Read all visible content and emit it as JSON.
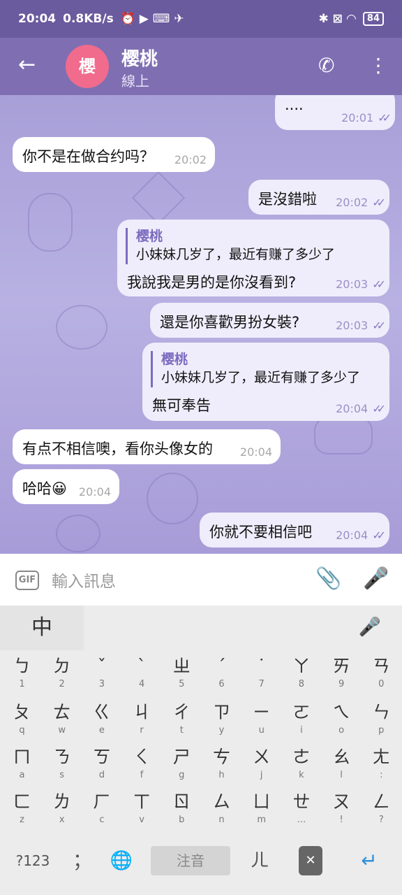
{
  "status_bar": {
    "time": "20:04",
    "speed": "0.8KB/s",
    "battery": "84",
    "left_icons": "⏰ ▶ ⌨ ✈",
    "right_icons": "✱ ⊠ ◠"
  },
  "header": {
    "back_icon": "←",
    "avatar_initial": "櫻",
    "contact_name": "樱桃",
    "presence": "線上",
    "call_icon": "✆",
    "menu_icon": "⋮"
  },
  "messages": [
    {
      "side": "out",
      "text": "....",
      "time": "20:01"
    },
    {
      "side": "in",
      "text": "你不是在做合约吗？",
      "time": "20:02"
    },
    {
      "side": "out",
      "text": "是沒錯啦",
      "time": "20:02"
    },
    {
      "side": "out",
      "reply_name": "樱桃",
      "reply_text": "小妹妹几岁了，最近有赚了多少了",
      "text": "我說我是男的是你沒看到?",
      "time": "20:03"
    },
    {
      "side": "out",
      "text": "還是你喜歡男扮女裝?",
      "time": "20:03"
    },
    {
      "side": "out",
      "reply_name": "樱桃",
      "reply_text": "小妹妹几岁了，最近有赚了多少了",
      "text": "無可奉告",
      "time": "20:04"
    },
    {
      "side": "in",
      "text": "有点不相信噢，看你头像女的",
      "time": "20:04"
    },
    {
      "side": "in",
      "text": "哈哈😀",
      "time": "20:04"
    },
    {
      "side": "out",
      "text": "你就不要相信吧",
      "time": "20:04"
    }
  ],
  "read_check": "✓✓",
  "input": {
    "gif_label": "GIF",
    "placeholder": "輸入訊息",
    "attach_icon": "📎",
    "mic_icon": "🎤"
  },
  "keyboard": {
    "lang_label": "中",
    "mic_icon": "🎤",
    "rows": [
      [
        {
          "m": "ㄅ",
          "s": "1"
        },
        {
          "m": "ㄉ",
          "s": "2"
        },
        {
          "m": "ˇ",
          "s": "3"
        },
        {
          "m": "ˋ",
          "s": "4"
        },
        {
          "m": "ㄓ",
          "s": "5"
        },
        {
          "m": "ˊ",
          "s": "6"
        },
        {
          "m": "˙",
          "s": "7"
        },
        {
          "m": "ㄚ",
          "s": "8"
        },
        {
          "m": "ㄞ",
          "s": "9"
        },
        {
          "m": "ㄢ",
          "s": "0"
        }
      ],
      [
        {
          "m": "ㄆ",
          "s": "q"
        },
        {
          "m": "ㄊ",
          "s": "w"
        },
        {
          "m": "ㄍ",
          "s": "e"
        },
        {
          "m": "ㄐ",
          "s": "r"
        },
        {
          "m": "ㄔ",
          "s": "t"
        },
        {
          "m": "ㄗ",
          "s": "y"
        },
        {
          "m": "ㄧ",
          "s": "u"
        },
        {
          "m": "ㄛ",
          "s": "i"
        },
        {
          "m": "ㄟ",
          "s": "o"
        },
        {
          "m": "ㄣ",
          "s": "p"
        }
      ],
      [
        {
          "m": "ㄇ",
          "s": "a"
        },
        {
          "m": "ㄋ",
          "s": "s"
        },
        {
          "m": "ㄎ",
          "s": "d"
        },
        {
          "m": "ㄑ",
          "s": "f"
        },
        {
          "m": "ㄕ",
          "s": "g"
        },
        {
          "m": "ㄘ",
          "s": "h"
        },
        {
          "m": "ㄨ",
          "s": "j"
        },
        {
          "m": "ㄜ",
          "s": "k"
        },
        {
          "m": "ㄠ",
          "s": "l"
        },
        {
          "m": "ㄤ",
          "s": ":"
        }
      ],
      [
        {
          "m": "ㄈ",
          "s": "z"
        },
        {
          "m": "ㄌ",
          "s": "x"
        },
        {
          "m": "ㄏ",
          "s": "c"
        },
        {
          "m": "ㄒ",
          "s": "v"
        },
        {
          "m": "ㄖ",
          "s": "b"
        },
        {
          "m": "ㄙ",
          "s": "n"
        },
        {
          "m": "ㄩ",
          "s": "m"
        },
        {
          "m": "ㄝ",
          "s": "…"
        },
        {
          "m": "ㄡ",
          "s": "!"
        },
        {
          "m": "ㄥ",
          "s": "?"
        }
      ]
    ],
    "bottom": {
      "num_label": "?123",
      "punct_label": "；",
      "globe_icon": "🌐",
      "space_label": "注音",
      "er_label": "ㄦ",
      "delete_icon": "✕",
      "enter_icon": "↵"
    }
  }
}
